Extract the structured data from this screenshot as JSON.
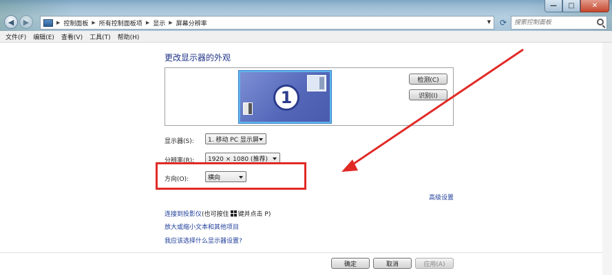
{
  "breadcrumb": [
    "控制面板",
    "所有控制面板项",
    "显示",
    "屏幕分辨率"
  ],
  "search": {
    "placeholder": "搜索控制面板"
  },
  "menu": [
    "文件(F)",
    "编辑(E)",
    "查看(V)",
    "工具(T)",
    "帮助(H)"
  ],
  "page": {
    "heading": "更改显示器的外观"
  },
  "monitor": {
    "number": "1"
  },
  "buttons": {
    "detect": "检测(C)",
    "identify": "识别(I)",
    "ok": "确定",
    "cancel": "取消",
    "apply": "应用(A)"
  },
  "fields": {
    "display": {
      "label": "显示器(S):",
      "value": "1. 移动 PC 显示屏"
    },
    "resolution": {
      "label": "分辨率(R):",
      "value": "1920 × 1080 (推荐)"
    },
    "orientation": {
      "label": "方向(O):",
      "value": "横向"
    }
  },
  "links": {
    "advanced": "高级设置",
    "projector_prefix": "连接到投影仪",
    "projector_mid": "(也可按住",
    "projector_suffix": "键并点击 P)",
    "text_size": "放大或缩小文本和其他项目",
    "which_settings": "我应该选择什么显示器设置?"
  },
  "colors": {
    "accent_link": "#1f3d99",
    "highlight_red": "#e02a26",
    "monitor_blue": "#5366b8"
  }
}
